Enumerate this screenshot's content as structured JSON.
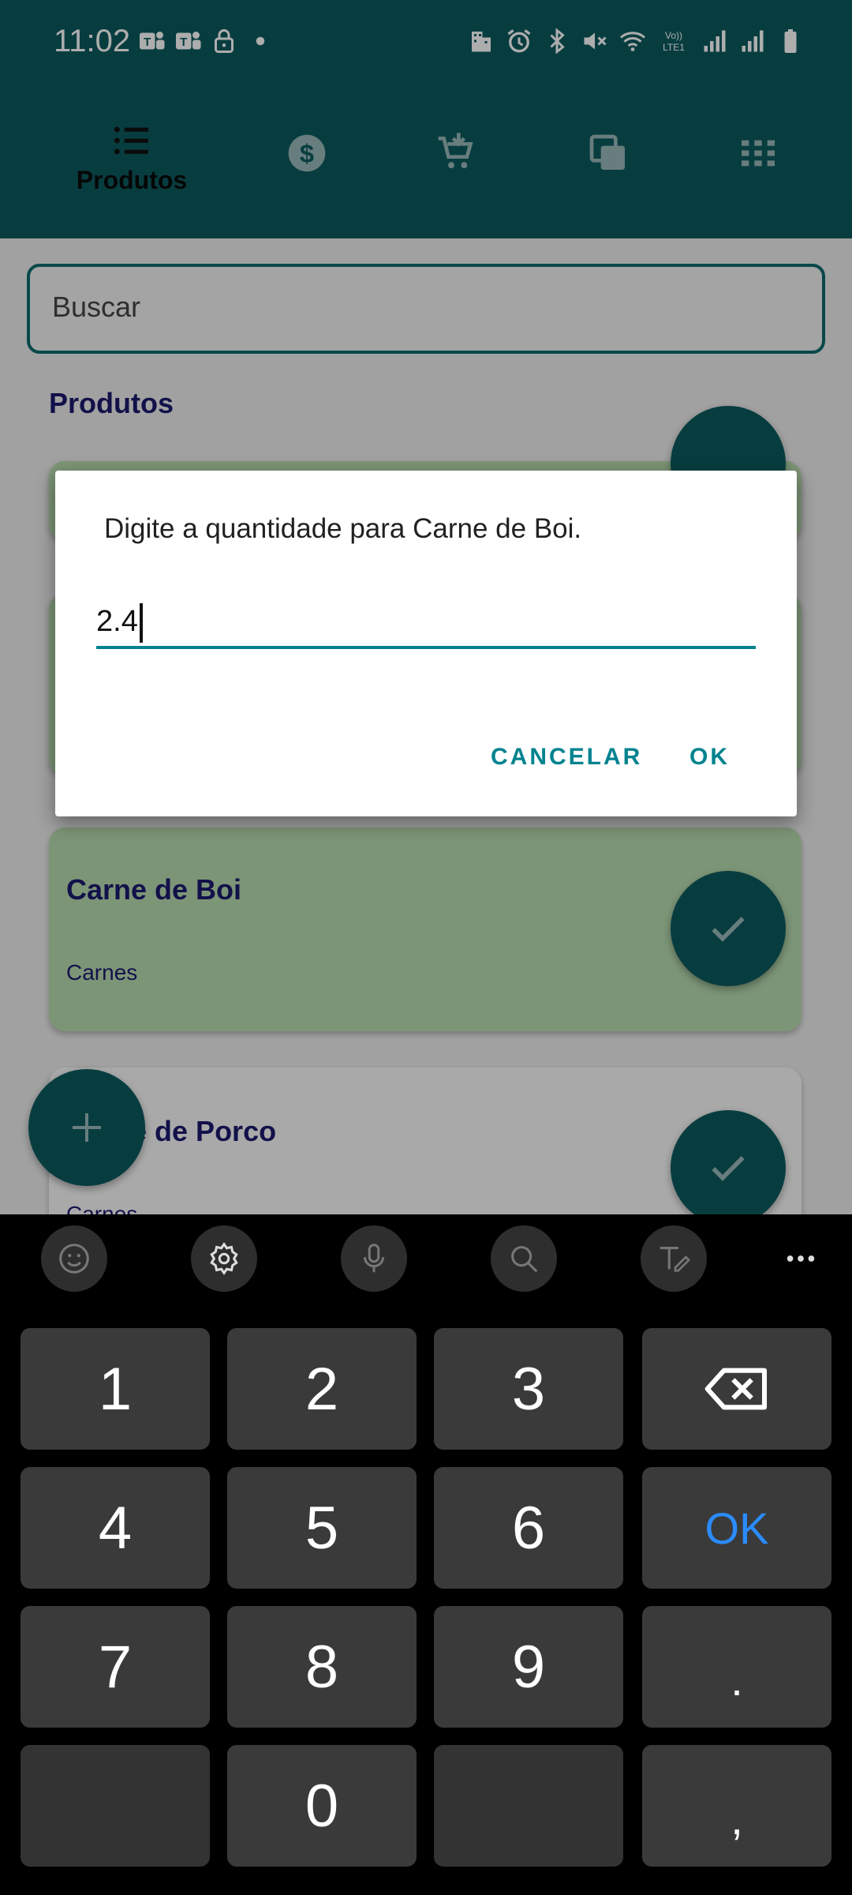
{
  "status_bar": {
    "time": "11:02",
    "left_icons": [
      "teams-icon",
      "teams-icon",
      "lock-icon",
      "dot-icon"
    ],
    "right_icons": [
      "building-icon",
      "alarm-icon",
      "bluetooth-icon",
      "mute-icon",
      "wifi-icon",
      "volte-icon",
      "signal-icon",
      "signal-icon",
      "battery-icon"
    ],
    "volte_label": "Vo)) LTE1"
  },
  "nav": {
    "tabs": [
      {
        "label": "Produtos",
        "icon": "list-icon",
        "active": true
      },
      {
        "label": "",
        "icon": "dollar-icon",
        "active": false
      },
      {
        "label": "",
        "icon": "cart-add-icon",
        "active": false
      },
      {
        "label": "",
        "icon": "copy-icon",
        "active": false
      },
      {
        "label": "",
        "icon": "grid-icon",
        "active": false
      }
    ]
  },
  "search": {
    "placeholder": "Buscar",
    "value": ""
  },
  "section_title": "Produtos",
  "products": [
    {
      "name": "Carne de Boi",
      "category": "Carnes",
      "selected": true
    },
    {
      "name": "Carne de Porco",
      "category": "Carnes",
      "selected": false
    }
  ],
  "dialog": {
    "title": "Digite a quantidade para Carne de Boi.",
    "value": "2.4",
    "cancel_label": "CANCELAR",
    "ok_label": "OK"
  },
  "keyboard": {
    "toolbar": [
      "emoji-icon",
      "settings-icon",
      "mic-icon",
      "search-icon",
      "handwriting-icon",
      "more-icon"
    ],
    "keys": {
      "k1": "1",
      "k2": "2",
      "k3": "3",
      "k4": "4",
      "k5": "5",
      "k6": "6",
      "k7": "7",
      "k8": "8",
      "k9": "9",
      "k0": "0",
      "dot": ".",
      "comma": ",",
      "ok": "OK"
    }
  },
  "colors": {
    "primary": "#0d5b5f",
    "accent": "#00838f",
    "selected_card": "#b8dcb0",
    "title_text": "#1b1a6e",
    "keyboard_ok": "#2a8cff"
  }
}
